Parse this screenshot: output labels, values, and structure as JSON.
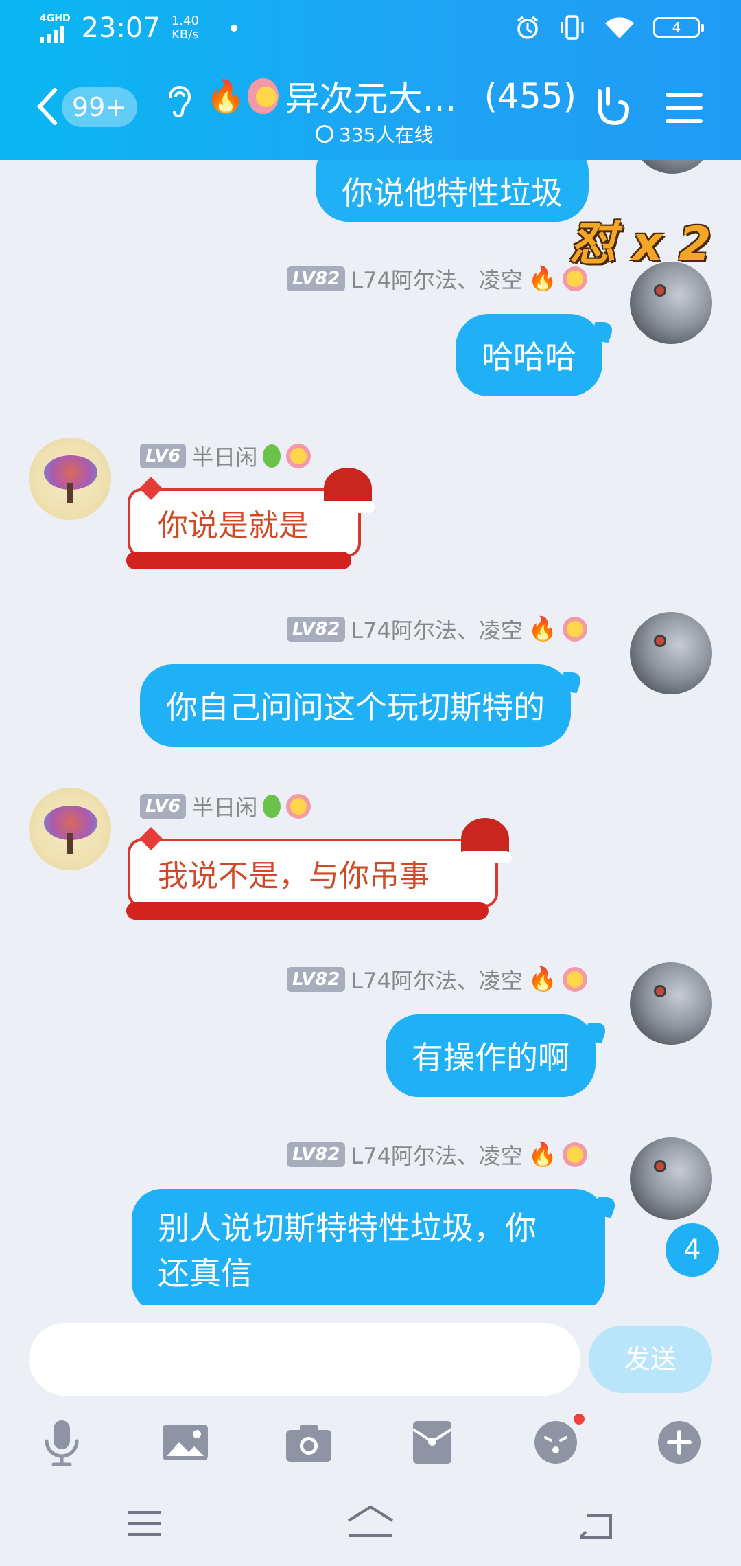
{
  "status_bar": {
    "network": "4GHD",
    "time": "23:07",
    "speed_value": "1.40",
    "speed_unit": "KB/s",
    "battery": "4"
  },
  "header": {
    "unread_count": "99+",
    "group_title": "异次元大…",
    "member_count": "(455)",
    "online_text": "335人在线"
  },
  "badge": {
    "dui_text": "怼 x 2",
    "new_messages": "4"
  },
  "messages": [
    {
      "text": "你说他特性垃圾"
    },
    {
      "level": "LV82",
      "sender": "L74阿尔法、凌空",
      "text": "哈哈哈"
    },
    {
      "level": "LV6",
      "sender": "半日闲",
      "text": "你说是就是"
    },
    {
      "level": "LV82",
      "sender": "L74阿尔法、凌空",
      "text": "你自己问问这个玩切斯特的"
    },
    {
      "level": "LV6",
      "sender": "半日闲",
      "text": "我说不是，与你吊事"
    },
    {
      "level": "LV82",
      "sender": "L74阿尔法、凌空",
      "text": "有操作的啊"
    },
    {
      "level": "LV82",
      "sender": "L74阿尔法、凌空",
      "text_line1": "别人说切斯特特性垃圾，你",
      "text_line2": "还真信"
    }
  ],
  "input": {
    "value": "",
    "send_label": "发送"
  },
  "colors": {
    "header_blue": "#1fa3f4",
    "bubble_blue": "#1fb0f6",
    "chat_bg": "#eceff5"
  },
  "icons": [
    "back-icon",
    "ear-icon",
    "fire-emoji",
    "laugh-emoji",
    "hand-icon",
    "menu-icon",
    "mic-icon",
    "image-icon",
    "camera-icon",
    "red-packet-icon",
    "emoji-icon",
    "plus-icon"
  ]
}
